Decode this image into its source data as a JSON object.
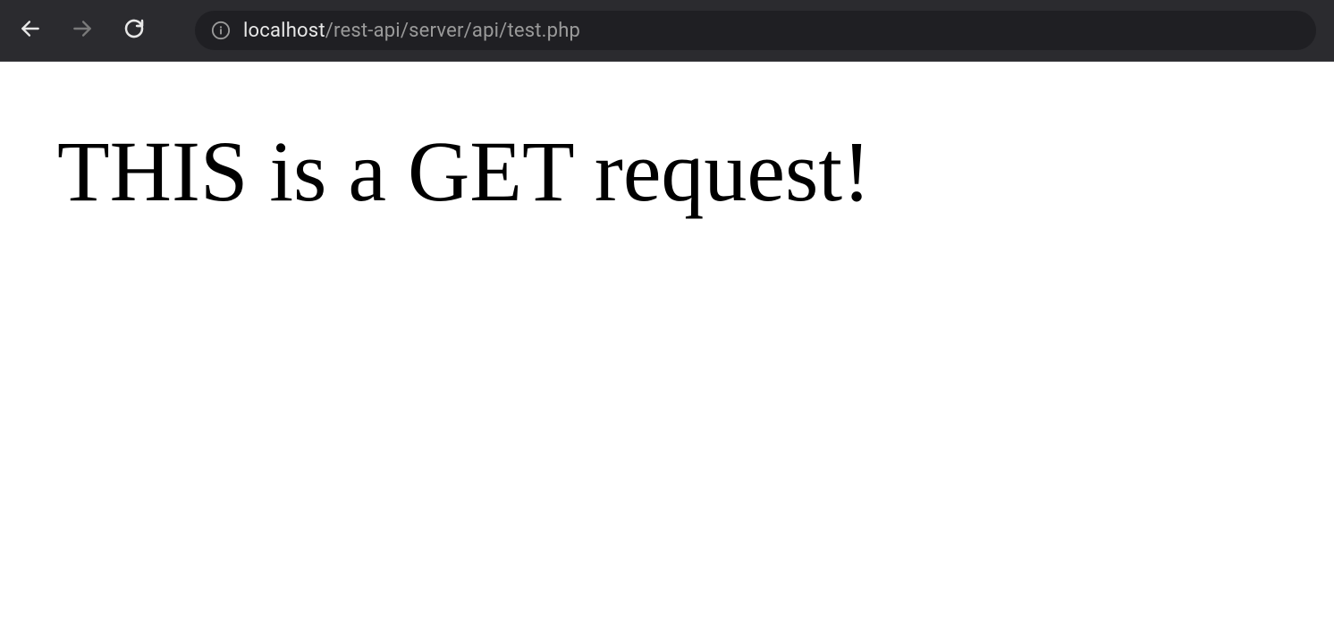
{
  "browser": {
    "url_host": "localhost",
    "url_path": "/rest-api/server/api/test.php"
  },
  "page": {
    "heading": "THIS is a GET request!"
  }
}
